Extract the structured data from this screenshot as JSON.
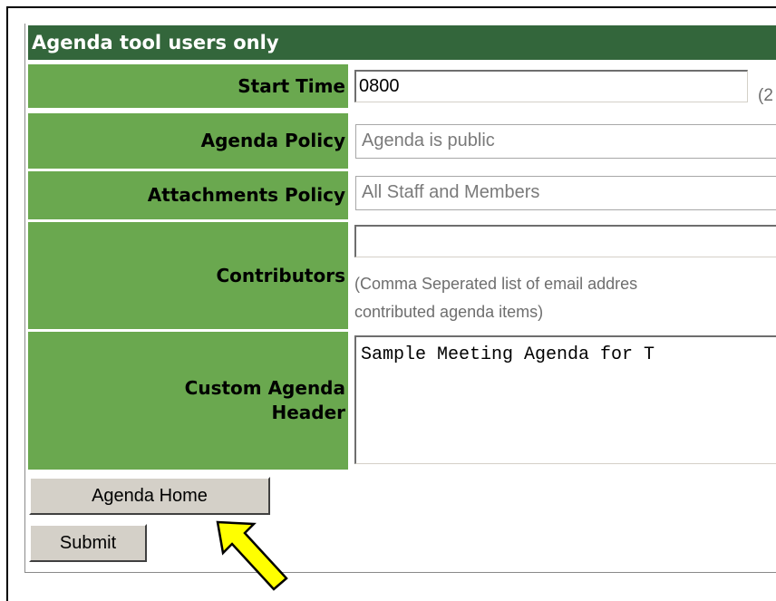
{
  "section": {
    "title": "Agenda tool users only"
  },
  "fields": {
    "start_time": {
      "label": "Start Time",
      "value": "0800",
      "suffix": "(2"
    },
    "agenda_policy": {
      "label": "Agenda Policy",
      "value": "Agenda is public"
    },
    "attachments_policy": {
      "label": "Attachments Policy",
      "value": "All Staff and Members"
    },
    "contributors": {
      "label": "Contributors",
      "value": "",
      "hint_line1": "(Comma Seperated list of email addres",
      "hint_line2": "contributed agenda items)"
    },
    "custom_header": {
      "label": "Custom Agenda\nHeader",
      "value": "Sample Meeting Agenda for T"
    }
  },
  "buttons": {
    "agenda_home": "Agenda Home",
    "submit": "Submit"
  },
  "colors": {
    "header_green": "#33663b",
    "label_green": "#6aa84f",
    "arrow_fill": "#ffff00"
  },
  "annotation": {
    "arrow_icon": "yellow-arrow-pointer-icon"
  }
}
